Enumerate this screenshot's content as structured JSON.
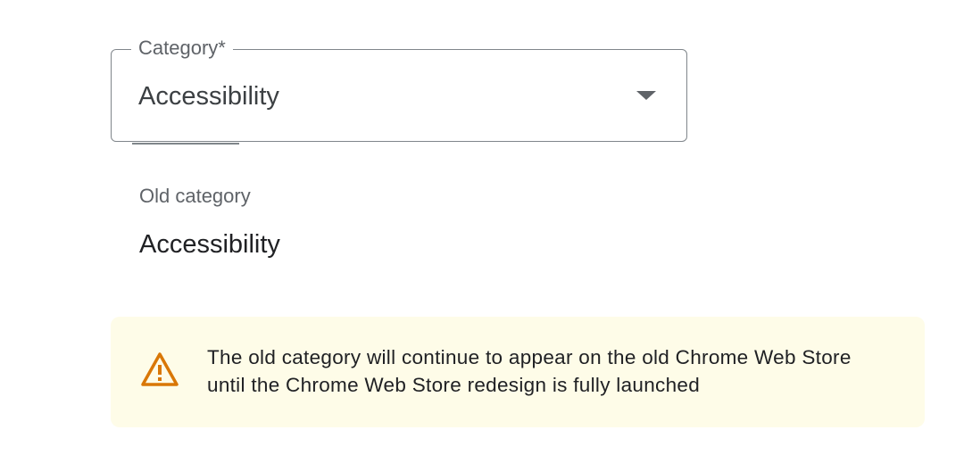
{
  "category_select": {
    "label": "Category*",
    "value": "Accessibility"
  },
  "old_category": {
    "label": "Old category",
    "value": "Accessibility"
  },
  "notice": {
    "icon": "warning-icon",
    "text_line1": "The old category will continue to appear on the old Chrome Web Store",
    "text_line2": "until the Chrome Web Store redesign is fully launched"
  },
  "colors": {
    "warning_icon": "#d97706",
    "notice_background": "#fefce8",
    "border": "#80868b"
  }
}
